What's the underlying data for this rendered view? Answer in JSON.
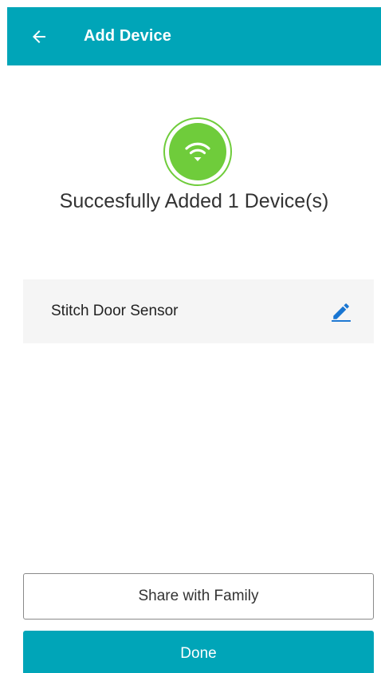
{
  "app_bar": {
    "title": "Add Device",
    "back_icon": "arrow-left-icon",
    "color": "#00A5B8"
  },
  "status": {
    "icon": "wifi-icon",
    "color": "#6FCC3B",
    "message": "Succesfully Added 1 Device(s)"
  },
  "devices": [
    {
      "name": "Stitch Door Sensor",
      "edit_icon": "pencil-icon",
      "edit_icon_color": "#1976D2"
    }
  ],
  "actions": {
    "share_label": "Share with Family",
    "done_label": "Done"
  }
}
